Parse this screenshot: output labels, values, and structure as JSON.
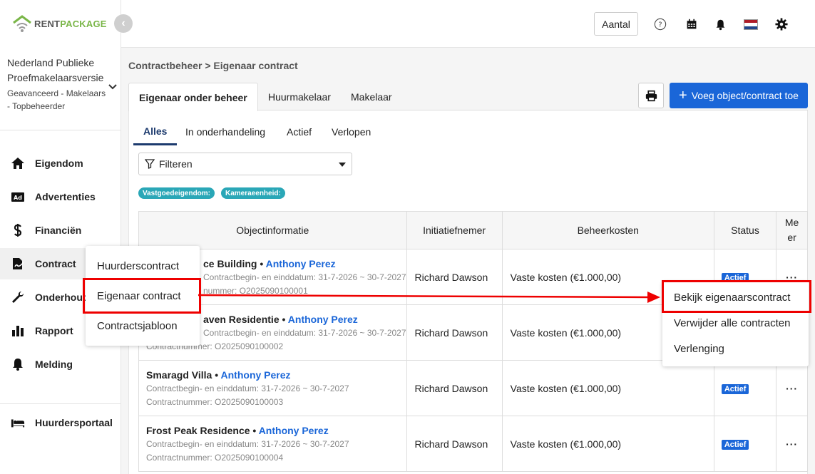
{
  "brand": {
    "name_part1": "RENT",
    "name_part2": "PACKAGE",
    "accent": "#7ab648"
  },
  "org": {
    "name": "Nederland Publieke Proefmakelaarsversie",
    "role": "Geavanceerd - Makelaars - Topbeheerder"
  },
  "sidebar": {
    "items": [
      {
        "label": "Eigendom",
        "icon": "home-icon"
      },
      {
        "label": "Advertenties",
        "icon": "ad-icon"
      },
      {
        "label": "Financiën",
        "icon": "dollar-icon"
      },
      {
        "label": "Contract",
        "icon": "contract-icon"
      },
      {
        "label": "Onderhoud",
        "icon": "wrench-icon"
      },
      {
        "label": "Rapport",
        "icon": "bar-chart-icon"
      },
      {
        "label": "Melding",
        "icon": "bell-icon"
      }
    ],
    "portal": {
      "label": "Huurdersportaal",
      "icon": "bed-icon"
    }
  },
  "topbar": {
    "aantal": "Aantal",
    "language_flag": "nl"
  },
  "breadcrumb": "Contractbeheer > Eigenaar contract",
  "main_tabs": [
    "Eigenaar onder beheer",
    "Huurmakelaar",
    "Makelaar"
  ],
  "add_button": "Voeg object/contract toe",
  "status_tabs": [
    "Alles",
    "In onderhandeling",
    "Actief",
    "Verlopen"
  ],
  "filter": {
    "label": "Filteren"
  },
  "chips": [
    "Vastgoedeigendom:",
    "Kameraeenheid:"
  ],
  "table": {
    "headers": [
      "Objectinformatie",
      "Initiatiefnemer",
      "Beheerkosten",
      "Status",
      "Me er"
    ],
    "rows": [
      {
        "name": "ce Building",
        "person": "Anthony Perez",
        "dates": "Contractbegin- en einddatum: 31-7-2026 ~ 30-7-2027",
        "number": "nummer: O2025090100001",
        "initiator": "Richard Dawson",
        "cost": "Vaste kosten (€1.000,00)",
        "status": "Actief"
      },
      {
        "name": "aven Residentie",
        "person": "Anthony Perez",
        "dates": "Contractbegin- en einddatum: 31-7-2026 ~ 30-7-2027",
        "number": "Contractnummer: O2025090100002",
        "initiator": "Richard Dawson",
        "cost": "Vaste kosten (€1.000,00)",
        "status": ""
      },
      {
        "name": "Smaragd Villa",
        "person": "Anthony Perez",
        "dates": "Contractbegin- en einddatum: 31-7-2026 ~ 30-7-2027",
        "number": "Contractnummer: O2025090100003",
        "initiator": "Richard Dawson",
        "cost": "Vaste kosten (€1.000,00)",
        "status": "Actief"
      },
      {
        "name": "Frost Peak Residence",
        "person": "Anthony Perez",
        "dates": "Contractbegin- en einddatum: 31-7-2026 ~ 30-7-2027",
        "number": "Contractnummer: O2025090100004",
        "initiator": "Richard Dawson",
        "cost": "Vaste kosten (€1.000,00)",
        "status": "Actief"
      }
    ]
  },
  "contract_menu": [
    "Huurderscontract",
    "Eigenaar contract",
    "Contractsjabloon"
  ],
  "row_menu": [
    "Bekijk eigenaarscontract",
    "Verwijder alle contracten",
    "Verlenging"
  ]
}
